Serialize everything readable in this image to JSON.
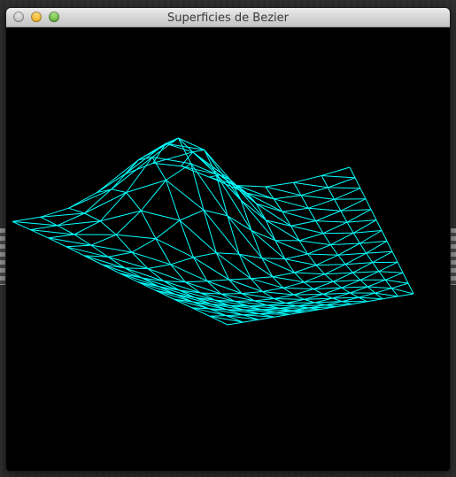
{
  "window": {
    "title": "Superficies de Bezier",
    "controls": {
      "close": "close-icon",
      "minimize": "minimize-icon",
      "zoom": "zoom-icon"
    }
  },
  "canvas": {
    "background_color": "#000000",
    "wire_color": "#00FFFF",
    "content": "bezier-surface-wireframe"
  }
}
